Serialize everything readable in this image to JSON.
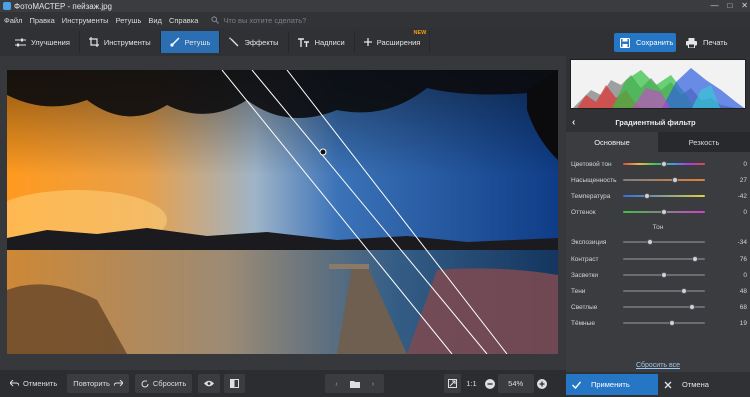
{
  "window": {
    "title": "ФотоМАСТЕР - пейзаж.jpg",
    "controls": [
      "—",
      "□",
      "✕"
    ]
  },
  "menu": {
    "items": [
      "Файл",
      "Правка",
      "Инструменты",
      "Ретушь",
      "Вид",
      "Справка"
    ],
    "search_placeholder": "Что вы хотите сделать?"
  },
  "toolbar": {
    "tabs": [
      {
        "label": "Улучшения",
        "icon": "sliders-icon"
      },
      {
        "label": "Инструменты",
        "icon": "crop-icon"
      },
      {
        "label": "Ретушь",
        "icon": "brush-icon"
      },
      {
        "label": "Эффекты",
        "icon": "magic-wand-icon"
      },
      {
        "label": "Надписи",
        "icon": "text-icon"
      },
      {
        "label": "Расширения",
        "icon": "plus-icon"
      }
    ],
    "active_tab": "Ретушь",
    "new_badge": "NEW",
    "save_label": "Сохранить",
    "print_label": "Печать"
  },
  "bottom": {
    "undo_label": "Отменить",
    "redo_label": "Повторить",
    "reset_label": "Сбросить",
    "ratio_label": "1:1",
    "zoom_value": "54%"
  },
  "panel": {
    "filter_title": "Градиентный фильтр",
    "tabs": [
      "Основные",
      "Резкость"
    ],
    "section_label": "Тон",
    "color_sliders": [
      {
        "label": "Цветовой тон",
        "value": "0",
        "pos": 0.5
      },
      {
        "label": "Насыщенность",
        "value": "27",
        "pos": 0.63
      },
      {
        "label": "Температура",
        "value": "-42",
        "pos": 0.29
      },
      {
        "label": "Оттенок",
        "value": "0",
        "pos": 0.5
      }
    ],
    "tone_sliders": [
      {
        "label": "Экспозиция",
        "value": "-34",
        "pos": 0.33
      },
      {
        "label": "Контраст",
        "value": "76",
        "pos": 0.88
      },
      {
        "label": "Засветки",
        "value": "0",
        "pos": 0.5
      },
      {
        "label": "Тени",
        "value": "48",
        "pos": 0.74
      },
      {
        "label": "Светлые",
        "value": "68",
        "pos": 0.84
      },
      {
        "label": "Тёмные",
        "value": "19",
        "pos": 0.6
      }
    ],
    "reset_all_label": "Сбросить все",
    "apply_label": "Применить",
    "cancel_label": "Отмена"
  },
  "colors": {
    "accent": "#2576c4",
    "new_badge": "#f39c12",
    "link": "#9fc7ef"
  }
}
